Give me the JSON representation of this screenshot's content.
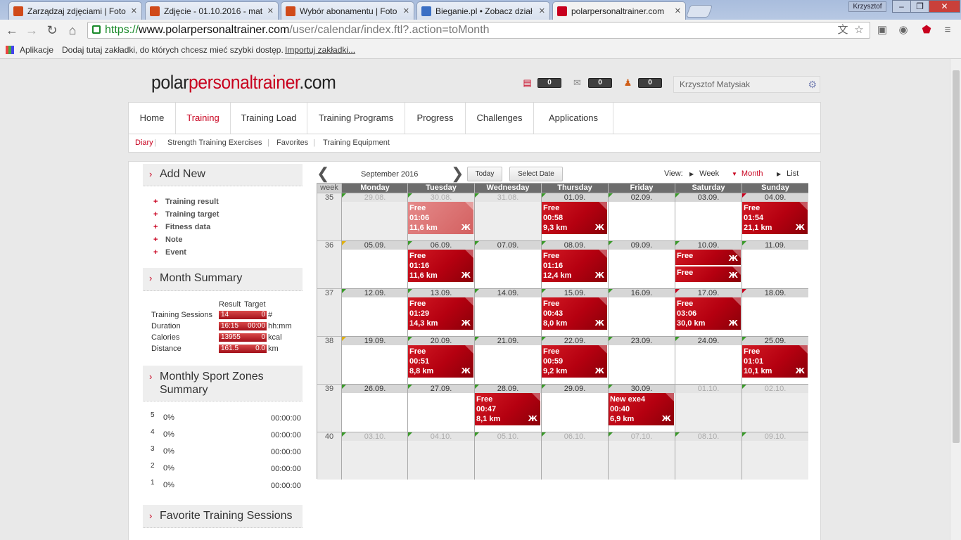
{
  "browser": {
    "tabs": [
      {
        "title": "Zarządzaj zdjęciami | Foto",
        "favicon_color": "#d04a1a"
      },
      {
        "title": "Zdjęcie - 01.10.2016 - mat",
        "favicon_color": "#d04a1a"
      },
      {
        "title": "Wybór abonamentu | Foto",
        "favicon_color": "#d04a1a"
      },
      {
        "title": "Bieganie.pl • Zobacz dział",
        "favicon_color": "#3b6fc4"
      },
      {
        "title": "polarpersonaltrainer.com",
        "favicon_color": "#c8001e"
      }
    ],
    "window_user": "Krzysztof",
    "url_scheme": "https://",
    "url_host": "www.polarpersonaltrainer.com",
    "url_path": "/user/calendar/index.ftl?.action=toMonth",
    "bookmarks": {
      "apps_label": "Aplikacje",
      "hint": "Dodaj tutaj zakładki, do których chcesz mieć szybki dostęp.",
      "import_link": "Importuj zakładki..."
    }
  },
  "site": {
    "logo_part1": "polar",
    "logo_part2": "personaltrainer",
    "logo_part3": ".com",
    "counters": [
      "0",
      "0",
      "0"
    ],
    "user_name": "Krzysztof Matysiak",
    "nav": [
      "Home",
      "Training",
      "Training Load",
      "Training Programs",
      "Progress",
      "Challenges",
      "Applications"
    ],
    "nav_active": "Training",
    "subnav": [
      "Diary",
      "Strength Training Exercises",
      "Favorites",
      "Training Equipment"
    ],
    "subnav_active": "Diary"
  },
  "sidebar": {
    "add_new": {
      "title": "Add New",
      "links": [
        "Training result",
        "Training target",
        "Fitness data",
        "Note",
        "Event"
      ]
    },
    "month_summary": {
      "title": "Month Summary",
      "col_result": "Result",
      "col_target": "Target",
      "rows": [
        {
          "label": "Training Sessions",
          "result": "14",
          "target": "0",
          "unit": "#"
        },
        {
          "label": "Duration",
          "result": "16:15",
          "target": "00:00",
          "unit": "hh:mm"
        },
        {
          "label": "Calories",
          "result": "13955",
          "target": "0",
          "unit": "kcal"
        },
        {
          "label": "Distance",
          "result": "161.5",
          "target": "0.0",
          "unit": "km"
        }
      ]
    },
    "zones": {
      "title_line1": "Monthly Sport Zones",
      "title_line2": "Summary",
      "rows": [
        {
          "zone": "5",
          "pct": "0%",
          "time": "00:00:00"
        },
        {
          "zone": "4",
          "pct": "0%",
          "time": "00:00:00"
        },
        {
          "zone": "3",
          "pct": "0%",
          "time": "00:00:00"
        },
        {
          "zone": "2",
          "pct": "0%",
          "time": "00:00:00"
        },
        {
          "zone": "1",
          "pct": "0%",
          "time": "00:00:00"
        }
      ]
    },
    "favorites": {
      "title": "Favorite Training Sessions"
    }
  },
  "calendar": {
    "month_label": "September 2016",
    "today_btn": "Today",
    "select_date_btn": "Select Date",
    "view_label": "View:",
    "views": [
      "Week",
      "Month",
      "List"
    ],
    "active_view": "Month",
    "week_header": "week",
    "days": [
      "Monday",
      "Tuesday",
      "Wednesday",
      "Thursday",
      "Friday",
      "Saturday",
      "Sunday"
    ],
    "weeks": [
      {
        "num": "35",
        "dates": [
          "29.08.",
          "30.08.",
          "31.08.",
          "01.09.",
          "02.09.",
          "03.09.",
          "04.09."
        ],
        "other": [
          true,
          true,
          true,
          false,
          false,
          false,
          false
        ],
        "flags": [
          "green",
          "green",
          "green",
          "green",
          "green",
          "green",
          "red"
        ]
      },
      {
        "num": "36",
        "dates": [
          "05.09.",
          "06.09.",
          "07.09.",
          "08.09.",
          "09.09.",
          "10.09.",
          "11.09."
        ],
        "other": [
          false,
          false,
          false,
          false,
          false,
          false,
          false
        ],
        "flags": [
          "yellow",
          "green",
          "green",
          "green",
          "green",
          "green",
          "green"
        ]
      },
      {
        "num": "37",
        "dates": [
          "12.09.",
          "13.09.",
          "14.09.",
          "15.09.",
          "16.09.",
          "17.09.",
          "18.09."
        ],
        "other": [
          false,
          false,
          false,
          false,
          false,
          false,
          false
        ],
        "flags": [
          "green",
          "green",
          "green",
          "green",
          "green",
          "red",
          "red"
        ]
      },
      {
        "num": "38",
        "dates": [
          "19.09.",
          "20.09.",
          "21.09.",
          "22.09.",
          "23.09.",
          "24.09.",
          "25.09."
        ],
        "other": [
          false,
          false,
          false,
          false,
          false,
          false,
          false
        ],
        "flags": [
          "yellow",
          "green",
          "green",
          "green",
          "green",
          "green",
          "green"
        ]
      },
      {
        "num": "39",
        "dates": [
          "26.09.",
          "27.09.",
          "28.09.",
          "29.09.",
          "30.09.",
          "01.10.",
          "02.10."
        ],
        "other": [
          false,
          false,
          false,
          false,
          false,
          true,
          true
        ],
        "flags": [
          "green",
          "green",
          "green",
          "green",
          "green",
          "",
          "green"
        ]
      },
      {
        "num": "40",
        "dates": [
          "03.10.",
          "04.10.",
          "05.10.",
          "06.10.",
          "07.10.",
          "08.10.",
          "09.10."
        ],
        "other": [
          true,
          true,
          true,
          true,
          true,
          true,
          true
        ],
        "flags": [
          "green",
          "green",
          "green",
          "green",
          "green",
          "green",
          "green"
        ]
      }
    ],
    "events": [
      {
        "week": 0,
        "day": 1,
        "name": "Free",
        "time": "01:06",
        "dist": "11,6 km",
        "faded": true
      },
      {
        "week": 0,
        "day": 3,
        "name": "Free",
        "time": "00:58",
        "dist": "9,3 km"
      },
      {
        "week": 0,
        "day": 6,
        "name": "Free",
        "time": "01:54",
        "dist": "21,1 km"
      },
      {
        "week": 1,
        "day": 1,
        "name": "Free",
        "time": "01:16",
        "dist": "11,6 km"
      },
      {
        "week": 1,
        "day": 3,
        "name": "Free",
        "time": "01:16",
        "dist": "12,4 km"
      },
      {
        "week": 1,
        "day": 5,
        "name": "Free",
        "compact": true,
        "slot": 0
      },
      {
        "week": 1,
        "day": 5,
        "name": "Free",
        "compact": true,
        "slot": 1
      },
      {
        "week": 2,
        "day": 1,
        "name": "Free",
        "time": "01:29",
        "dist": "14,3 km"
      },
      {
        "week": 2,
        "day": 3,
        "name": "Free",
        "time": "00:43",
        "dist": "8,0 km"
      },
      {
        "week": 2,
        "day": 5,
        "name": "Free",
        "time": "03:06",
        "dist": "30,0 km"
      },
      {
        "week": 3,
        "day": 1,
        "name": "Free",
        "time": "00:51",
        "dist": "8,8 km"
      },
      {
        "week": 3,
        "day": 3,
        "name": "Free",
        "time": "00:59",
        "dist": "9,2 km"
      },
      {
        "week": 3,
        "day": 6,
        "name": "Free",
        "time": "01:01",
        "dist": "10,1 km"
      },
      {
        "week": 4,
        "day": 2,
        "name": "Free",
        "time": "00:47",
        "dist": "8,1 km"
      },
      {
        "week": 4,
        "day": 4,
        "name": "New exe4",
        "time": "00:40",
        "dist": "6,9 km"
      }
    ]
  }
}
